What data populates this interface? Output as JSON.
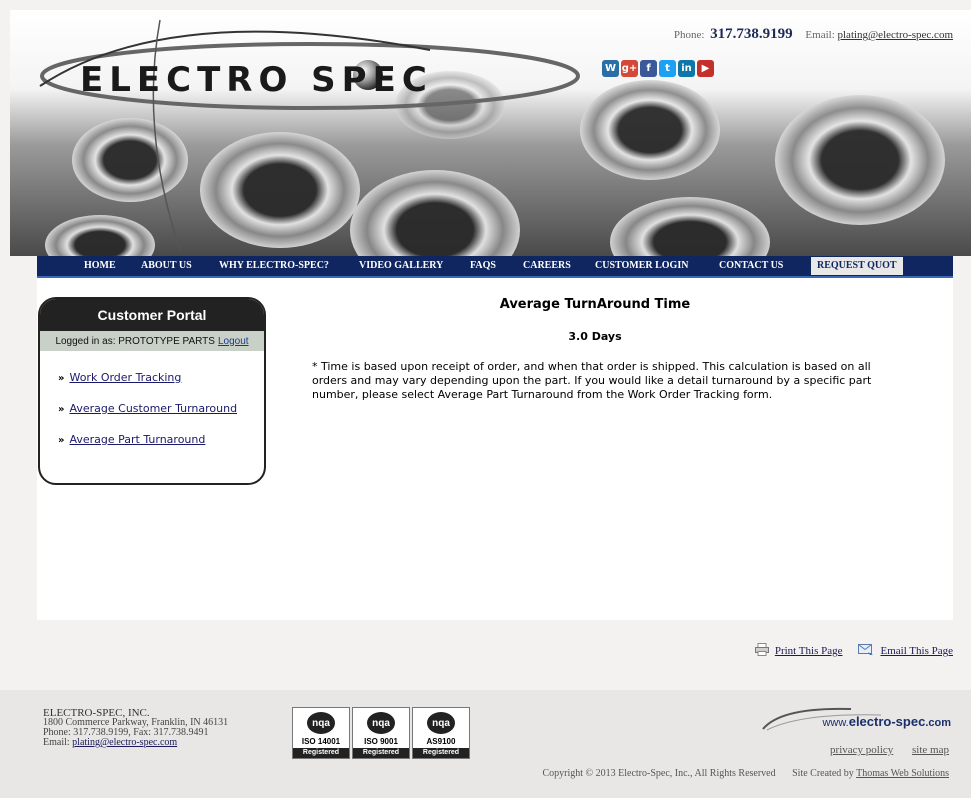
{
  "header": {
    "logo_text": "ELECTRO SPEC",
    "phone_label": "Phone:",
    "phone": "317.738.9199",
    "email_label": "Email:",
    "email": "plating@electro-spec.com"
  },
  "social": [
    {
      "icon": "wordpress-icon",
      "glyph": "W",
      "color": "#2b6ea5"
    },
    {
      "icon": "google-plus-icon",
      "glyph": "g+",
      "color": "#d34836"
    },
    {
      "icon": "facebook-icon",
      "glyph": "f",
      "color": "#3b5998"
    },
    {
      "icon": "twitter-icon",
      "glyph": "t",
      "color": "#1da1f2"
    },
    {
      "icon": "linkedin-icon",
      "glyph": "in",
      "color": "#0e76a8"
    },
    {
      "icon": "youtube-icon",
      "glyph": "▶",
      "color": "#c4302b"
    }
  ],
  "nav": [
    "HOME",
    "ABOUT US",
    "WHY ELECTRO-SPEC?",
    "VIDEO GALLERY",
    "FAQS",
    "CAREERS",
    "CUSTOMER LOGIN",
    "CONTACT US",
    "REQUEST QUOT"
  ],
  "portal": {
    "title": "Customer Portal",
    "logged_in": "Logged in as: PROTOTYPE PARTS",
    "logout": "Logout",
    "links": [
      "Work Order Tracking",
      "Average Customer Turnaround",
      "Average Part Turnaround"
    ],
    "arrow": "»"
  },
  "main": {
    "title": "Average TurnAround Time",
    "days": "3.0 Days",
    "note": "* Time is based upon receipt of order, and when that order is shipped. This calculation is based on all orders and may vary depending upon the part. If you would like a detail turnaround by a specific part number, please select Average Part Turnaround from the Work Order Tracking form."
  },
  "actions": {
    "print": "Print This Page",
    "email": "Email This Page"
  },
  "footer": {
    "company": "ELECTRO-SPEC, INC.",
    "address": "1800 Commerce Parkway, Franklin, IN 46131",
    "phone_fax": "Phone: 317.738.9199, Fax: 317.738.9491",
    "email_label": "Email:",
    "email": "plating@electro-spec.com",
    "badges": [
      {
        "logo": "nqa",
        "standard": "ISO 14001",
        "reg": "Registered"
      },
      {
        "logo": "nqa",
        "standard": "ISO 9001",
        "reg": "Registered"
      },
      {
        "logo": "nqa",
        "standard": "AS9100",
        "reg": "Registered"
      }
    ],
    "url_prefix": "www.",
    "url_main": "electro-spec",
    "url_suffix": ".com",
    "privacy": "privacy policy",
    "sitemap": "site map",
    "copyright": "Copyright © 2013 Electro-Spec, Inc., All Rights Reserved",
    "site_created": "Site Created by",
    "creator": "Thomas Web Solutions"
  }
}
